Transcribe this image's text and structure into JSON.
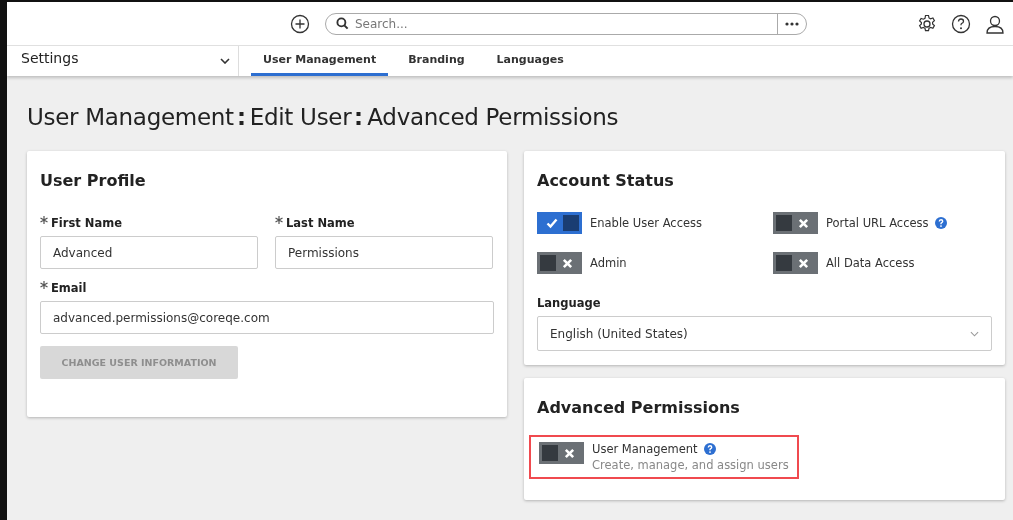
{
  "top_bar": {
    "search": {
      "placeholder": "Search..."
    }
  },
  "nav": {
    "section": "Settings",
    "tabs": [
      {
        "label": "User Management",
        "selected": true
      },
      {
        "label": "Branding",
        "selected": false
      },
      {
        "label": "Languages",
        "selected": false
      }
    ]
  },
  "page_title": [
    {
      "text": "User Management"
    },
    {
      "text": "Edit User"
    },
    {
      "text": "Advanced Permissions"
    }
  ],
  "user_profile": {
    "title": "User Profile",
    "fields": [
      {
        "label": "First Name",
        "value": "Advanced",
        "required": true
      },
      {
        "label": "Last Name",
        "value": "Permissions",
        "required": true
      },
      {
        "label": "Email",
        "value": "advanced.permissions@coreqe.com",
        "required": true
      }
    ],
    "button": {
      "label": "CHANGE USER INFORMATION",
      "disabled": true
    }
  },
  "account_status": {
    "title": "Account Status",
    "toggles": [
      {
        "label": "Enable User Access",
        "on": true,
        "help": false
      },
      {
        "label": "Portal URL Access",
        "on": false,
        "help": true
      },
      {
        "label": "Admin",
        "on": false,
        "help": false
      },
      {
        "label": "All Data Access",
        "on": false,
        "help": false
      }
    ],
    "language": {
      "label": "Language",
      "value": "English (United States)"
    }
  },
  "advanced_permissions": {
    "title": "Advanced Permissions",
    "toggles": [
      {
        "label": "User Management",
        "description": "Create, manage, and assign users",
        "on": false,
        "help": true,
        "highlighted": true
      }
    ]
  }
}
